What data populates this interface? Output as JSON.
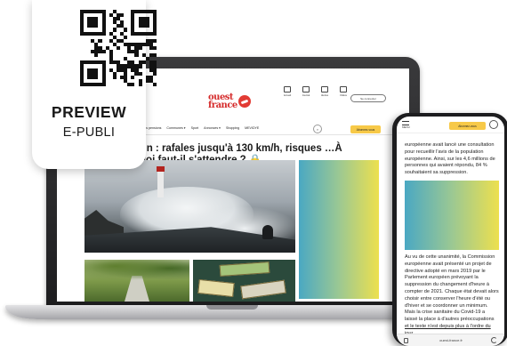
{
  "qr_card": {
    "title": "PREVIEW",
    "subtitle": "E-PUBLI"
  },
  "site": {
    "logo_line1": "ouest",
    "logo_line2": "france",
    "util_icons": [
      {
        "icon": "home-icon",
        "label": "Accueil"
      },
      {
        "icon": "journal-icon",
        "label": "Journal"
      },
      {
        "icon": "bell-icon",
        "label": "Alertes"
      },
      {
        "icon": "play-icon",
        "label": "Vidéos"
      }
    ],
    "connect_label": "Se connecter",
    "nav": [
      "Vos pensions",
      "Communes ▾",
      "Sport",
      "Annonces ▾",
      "Shopping",
      "MEVIDYE"
    ],
    "search_glyph": "⌕",
    "subscribe_label": "Abonnez-vous",
    "headline": "…in : rafales jusqu'à 130 km/h, risques …À quoi faut-il s'attendre ? 🔒"
  },
  "phone": {
    "menu_label": "MENU",
    "subscribe_label": "Abonnez-vous",
    "para1": "européenne avait lancé une consultation pour recueillir l'avis de la population européenne. Ainsi, sur les 4,6 millions de personnes qui avaient répondu, 84 % souhaitaient sa suppression.",
    "para2_main": "Au vu de cette unanimité, la Commission européenne avait présenté un projet de directive adopté en mars 2019 par le Parlement européen prévoyant la suppression du changement d'heure à compter de 2021. Chaque état devait alors choisir entre conserver l'heure d'été ou d'hiver et se coordonner un minimum. Mais la crise sanitaire du Covid-19 a laissé la place à d'autres préoccupations ",
    "para2_link": "et le texte n'est depuis plus à l'ordre du jour.",
    "url": "ouest-france.fr"
  },
  "colors": {
    "brand_red": "#d52b2b",
    "subscribe_yellow": "#f7c948",
    "ad_gradient_start": "#4aa8c3",
    "ad_gradient_end": "#ede04e"
  }
}
